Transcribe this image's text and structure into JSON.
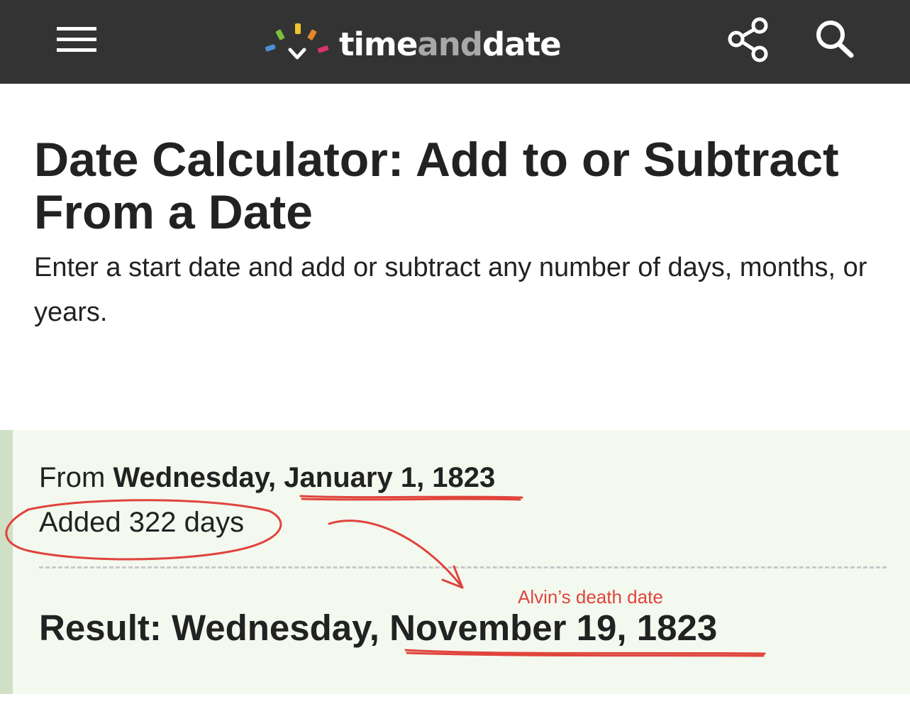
{
  "header": {
    "menu_icon": "hamburger-menu-icon",
    "logo": {
      "part1": "time",
      "part2": "and",
      "part3": "date",
      "dot_colors": [
        "#4a90d9",
        "#7bbf3a",
        "#f2c230",
        "#e8862c",
        "#d6336c"
      ]
    },
    "share_icon": "share-icon",
    "search_icon": "search-icon",
    "background_color": "#333333"
  },
  "main": {
    "title": "Date Calculator: Add to or Subtract From a Date",
    "intro": "Enter a start date and add or subtract any number of days, months, or years."
  },
  "result": {
    "from_prefix": "From",
    "from_weekday": "Wednesday,",
    "from_date": "January 1, 1823",
    "added": "Added 322 days",
    "result_prefix": "Result: Wednesday,",
    "result_date": "November 19, 1823",
    "background_color": "#f3f9ef"
  },
  "annotation": {
    "label": "Alvin’s death date",
    "color": "#e0443c"
  }
}
